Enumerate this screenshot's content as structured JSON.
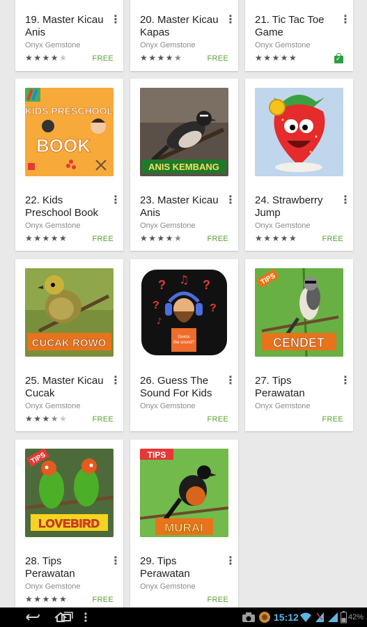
{
  "apps": [
    {
      "title": "19. Master Kicau Anis",
      "developer": "Onyx Gemstone",
      "rating": 4,
      "price": "FREE"
    },
    {
      "title": "20. Master Kicau Kapas",
      "developer": "Onyx Gemstone",
      "rating": 4.5,
      "price": "FREE"
    },
    {
      "title": "21. Tic Tac Toe Game",
      "developer": "Onyx Gemstone",
      "rating": 5,
      "price": "",
      "installed": true
    },
    {
      "title": "22. Kids Preschool Book",
      "developer": "Onyx Gemstone",
      "rating": 5,
      "price": "FREE",
      "image_text": [
        "KIDS PRESCHOOL",
        "BOOK"
      ]
    },
    {
      "title": "23. Master Kicau Anis",
      "developer": "Onyx Gemstone",
      "rating": 4.5,
      "price": "FREE",
      "image_text": [
        "ANIS KEMBANG"
      ]
    },
    {
      "title": "24. Strawberry Jump",
      "developer": "Onyx Gemstone",
      "rating": 5,
      "price": "FREE"
    },
    {
      "title": "25. Master Kicau Cucak",
      "developer": "Onyx Gemstone",
      "rating": 3.5,
      "price": "FREE",
      "image_text": [
        "CUCAK ROWO"
      ]
    },
    {
      "title": "26. Guess The Sound For Kids",
      "developer": "Onyx Gemstone",
      "rating": 0,
      "price": "FREE",
      "image_text": [
        "Guess",
        "the sound?"
      ]
    },
    {
      "title": "27. Tips Perawatan",
      "developer": "Onyx Gemstone",
      "rating": 0,
      "price": "FREE",
      "image_text": [
        "TIPS",
        "CENDET"
      ]
    },
    {
      "title": "28. Tips Perawatan",
      "developer": "Onyx Gemstone",
      "rating": 5,
      "price": "FREE",
      "image_text": [
        "TIPS",
        "LOVEBIRD"
      ]
    },
    {
      "title": "29. Tips Perawatan",
      "developer": "Onyx Gemstone",
      "rating": 0,
      "price": "FREE",
      "image_text": [
        "TIPS",
        "MURAI"
      ]
    }
  ],
  "status_bar": {
    "time": "15:12",
    "battery": "42%"
  },
  "icons": [
    "back-icon",
    "home-icon",
    "recent-apps-icon",
    "overflow-menu-icon",
    "camera-icon",
    "notification-avatar-icon",
    "wifi-icon",
    "signal-icon",
    "battery-icon"
  ],
  "colors": {
    "price_green": "#5aa032",
    "clock_blue": "#5cb8e6",
    "background": "#e9e9e9"
  }
}
